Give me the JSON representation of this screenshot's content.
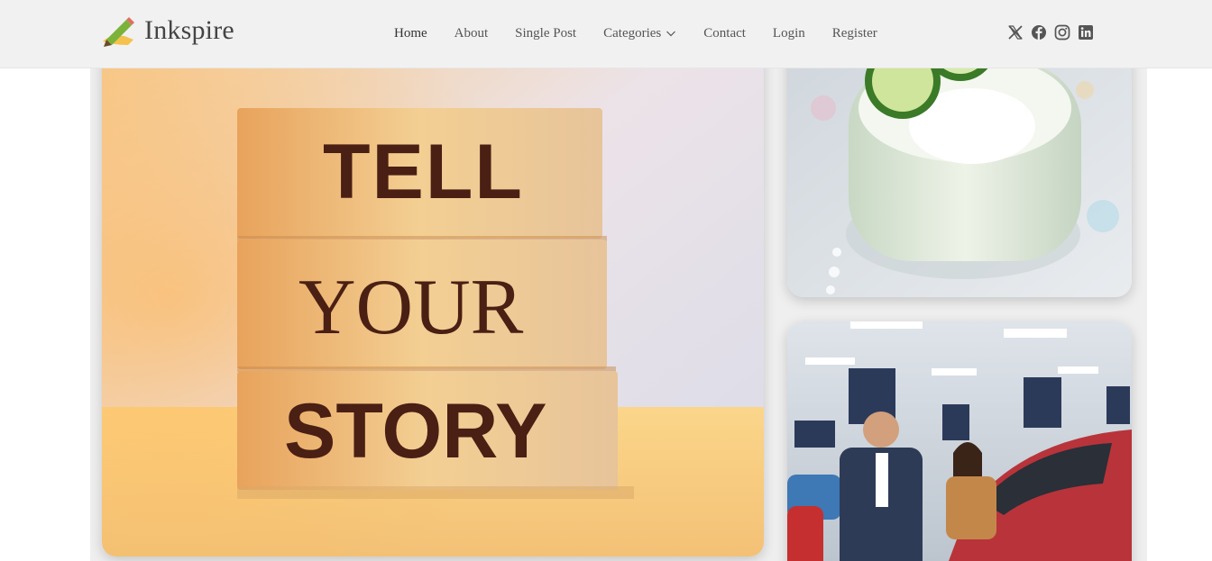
{
  "brand": {
    "name": "Inkspire",
    "logo_icon": "pencil-paper-icon"
  },
  "nav": {
    "items": [
      {
        "label": "Home",
        "active": true
      },
      {
        "label": "About"
      },
      {
        "label": "Single Post"
      },
      {
        "label": "Categories",
        "has_dropdown": true
      },
      {
        "label": "Contact"
      },
      {
        "label": "Login"
      },
      {
        "label": "Register"
      }
    ]
  },
  "social": [
    {
      "name": "x-twitter-icon"
    },
    {
      "name": "facebook-icon"
    },
    {
      "name": "instagram-icon"
    },
    {
      "name": "linkedin-icon"
    }
  ],
  "featured": {
    "image_words": [
      "TELL",
      "YOUR",
      "STORY"
    ]
  },
  "colors": {
    "header_bg": "#f1f1f1",
    "nav_text": "#555555",
    "brand_text": "#444444"
  }
}
